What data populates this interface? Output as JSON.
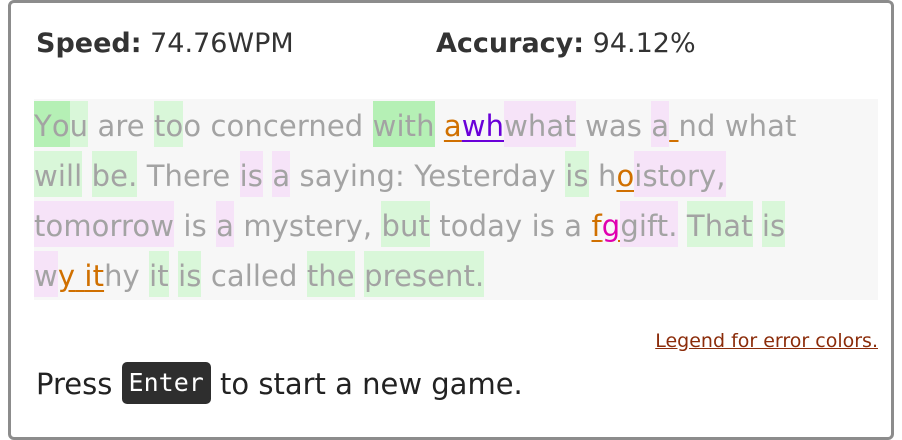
{
  "stats": {
    "speed_label": "Speed:",
    "speed_value": "74.76WPM",
    "accuracy_label": "Accuracy:",
    "accuracy_value": "94.12%"
  },
  "passage": {
    "line1": [
      {
        "t": "Y",
        "c": "g1"
      },
      {
        "t": "o",
        "c": "g1"
      },
      {
        "t": "u",
        "c": "g2"
      },
      {
        "t": " ",
        "c": ""
      },
      {
        "t": "are",
        "c": ""
      },
      {
        "t": " ",
        "c": ""
      },
      {
        "t": "to",
        "c": "g2"
      },
      {
        "t": "o",
        "c": ""
      },
      {
        "t": " ",
        "c": ""
      },
      {
        "t": "concerned",
        "c": ""
      },
      {
        "t": " ",
        "c": ""
      },
      {
        "t": "with",
        "c": "g1"
      },
      {
        "t": " ",
        "c": ""
      },
      {
        "t": "a",
        "c": "err-o"
      },
      {
        "t": "wh",
        "c": "err-p"
      },
      {
        "t": "what",
        "c": "p1"
      },
      {
        "t": " ",
        "c": ""
      },
      {
        "t": "was",
        "c": ""
      },
      {
        "t": " ",
        "c": ""
      },
      {
        "t": "a",
        "c": "p1"
      },
      {
        "t": " ",
        "c": "err-o"
      },
      {
        "t": "nd",
        "c": ""
      },
      {
        "t": " ",
        "c": ""
      },
      {
        "t": "what",
        "c": ""
      }
    ],
    "line2": [
      {
        "t": "will",
        "c": "g2"
      },
      {
        "t": " ",
        "c": ""
      },
      {
        "t": "be.",
        "c": "g2"
      },
      {
        "t": " ",
        "c": ""
      },
      {
        "t": "There",
        "c": ""
      },
      {
        "t": " ",
        "c": ""
      },
      {
        "t": "is",
        "c": "p1"
      },
      {
        "t": " ",
        "c": ""
      },
      {
        "t": "a",
        "c": "p1"
      },
      {
        "t": " ",
        "c": ""
      },
      {
        "t": "saying:",
        "c": ""
      },
      {
        "t": " ",
        "c": ""
      },
      {
        "t": "Yesterday",
        "c": ""
      },
      {
        "t": " ",
        "c": ""
      },
      {
        "t": "is",
        "c": "g2"
      },
      {
        "t": " ",
        "c": ""
      },
      {
        "t": "h",
        "c": ""
      },
      {
        "t": "o",
        "c": "err-o"
      },
      {
        "t": "istory,",
        "c": "p1"
      }
    ],
    "line3": [
      {
        "t": "tomorrow",
        "c": "p1"
      },
      {
        "t": " ",
        "c": ""
      },
      {
        "t": "is",
        "c": ""
      },
      {
        "t": " ",
        "c": ""
      },
      {
        "t": "a",
        "c": "p1"
      },
      {
        "t": " ",
        "c": ""
      },
      {
        "t": "mystery,",
        "c": ""
      },
      {
        "t": " ",
        "c": ""
      },
      {
        "t": "but",
        "c": "g2"
      },
      {
        "t": " ",
        "c": ""
      },
      {
        "t": "today",
        "c": ""
      },
      {
        "t": " ",
        "c": ""
      },
      {
        "t": "is",
        "c": ""
      },
      {
        "t": " ",
        "c": ""
      },
      {
        "t": "a",
        "c": ""
      },
      {
        "t": " ",
        "c": ""
      },
      {
        "t": "f",
        "c": "err-o"
      },
      {
        "t": "g",
        "c": "err-m"
      },
      {
        "t": "gift.",
        "c": "p1"
      },
      {
        "t": " ",
        "c": ""
      },
      {
        "t": "That",
        "c": "g2"
      },
      {
        "t": " ",
        "c": ""
      },
      {
        "t": "is",
        "c": "g2"
      }
    ],
    "line4": [
      {
        "t": "w",
        "c": "p1"
      },
      {
        "t": "y",
        "c": "err-o"
      },
      {
        "t": " ",
        "c": "err-o"
      },
      {
        "t": "it",
        "c": "err-o"
      },
      {
        "t": "hy",
        "c": ""
      },
      {
        "t": " ",
        "c": ""
      },
      {
        "t": "it",
        "c": "g2"
      },
      {
        "t": " ",
        "c": ""
      },
      {
        "t": "is",
        "c": "g2"
      },
      {
        "t": " ",
        "c": ""
      },
      {
        "t": "called",
        "c": ""
      },
      {
        "t": " ",
        "c": ""
      },
      {
        "t": "the",
        "c": "g2"
      },
      {
        "t": " ",
        "c": ""
      },
      {
        "t": "present.",
        "c": "g2"
      }
    ]
  },
  "legend_link": "Legend for error colors.",
  "restart": {
    "before": "Press",
    "key": "Enter",
    "after": "to start a new game."
  }
}
